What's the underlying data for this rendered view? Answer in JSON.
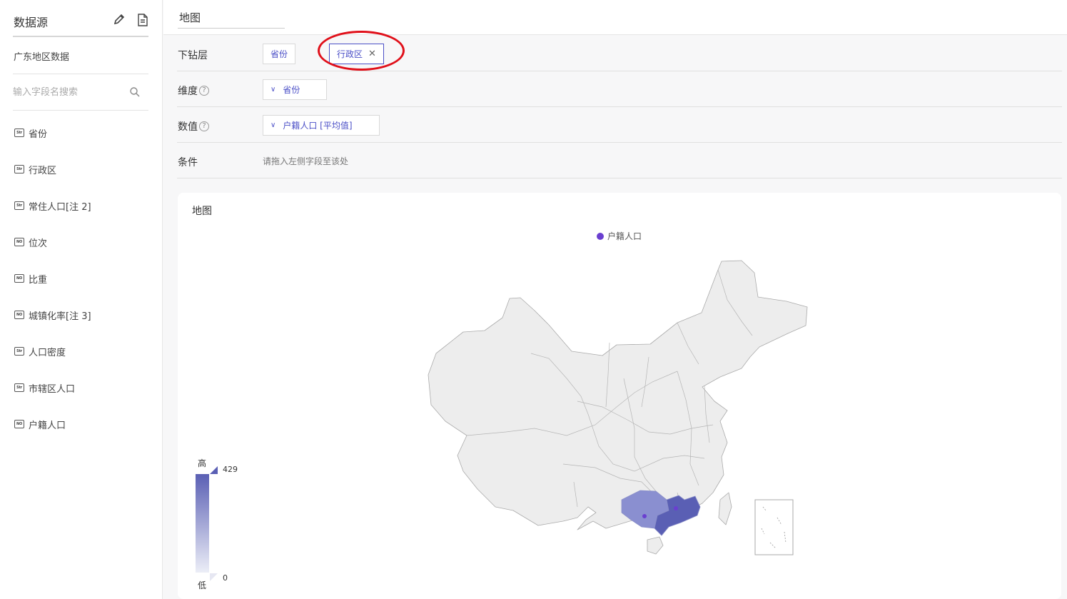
{
  "sidebar": {
    "title": "数据源",
    "dataset_name": "广东地区数据",
    "search_placeholder": "输入字段名搜索",
    "fields": [
      {
        "type": "Str",
        "name": "省份"
      },
      {
        "type": "Str",
        "name": "行政区"
      },
      {
        "type": "Str",
        "name": "常住人口[注 2]"
      },
      {
        "type": "NO",
        "name": "位次"
      },
      {
        "type": "NO",
        "name": "比重"
      },
      {
        "type": "NO",
        "name": "城镇化率[注 3]"
      },
      {
        "type": "Str",
        "name": "人口密度"
      },
      {
        "type": "Str",
        "name": "市辖区人口"
      },
      {
        "type": "NO",
        "name": "户籍人口"
      }
    ]
  },
  "editor": {
    "title_value": "地图",
    "drill": {
      "label": "下钻层",
      "chips": [
        "省份",
        "行政区"
      ]
    },
    "dimension": {
      "label": "维度",
      "chip": "省份"
    },
    "value": {
      "label": "数值",
      "chip": "户籍人口 [平均值]"
    },
    "condition": {
      "label": "条件",
      "placeholder": "请拖入左侧字段至该处"
    }
  },
  "chart": {
    "title": "地图",
    "legend": "户籍人口",
    "visual_map": {
      "high_label": "高",
      "low_label": "低",
      "max": "429",
      "min": "0"
    }
  },
  "chart_data": {
    "type": "map",
    "title": "地图",
    "series": [
      {
        "name": "户籍人口",
        "color": "#6a3fd0"
      }
    ],
    "visual_map": {
      "min": 0,
      "max": 429,
      "color_high": "#5a5fb4",
      "color_low": "#eceef7"
    },
    "highlighted_regions": [
      "广东",
      "广西"
    ]
  },
  "colors": {
    "accent": "#4b4fc7",
    "annotation": "#e0101a",
    "map_base": "#ededed"
  }
}
